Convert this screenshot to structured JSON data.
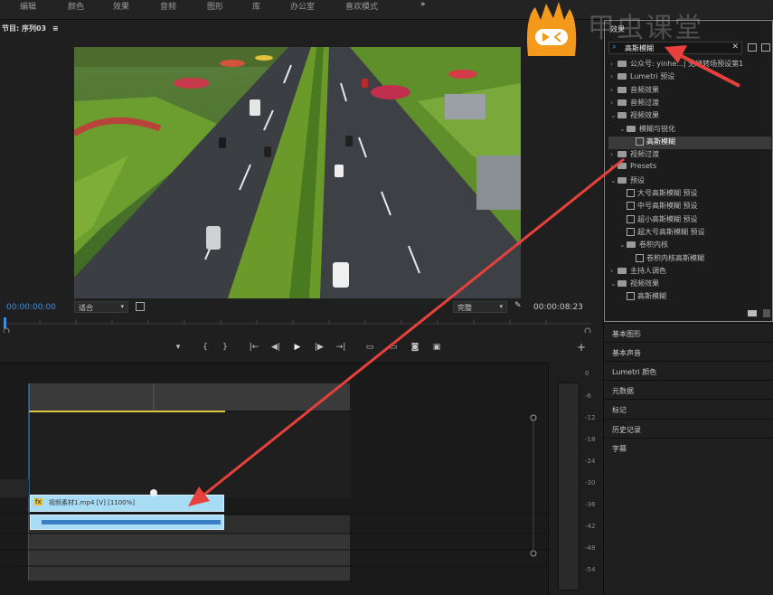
{
  "menu": [
    "编辑",
    "颜色",
    "效果",
    "音频",
    "图形",
    "库",
    "办公室",
    "喜欢模式"
  ],
  "menu_more": "»",
  "monitor": {
    "panel_title": "节目: 序列03",
    "panel_menu": "≡",
    "timecode_current": "00:00:00:00",
    "zoom_select": "适合",
    "quality_select": "完整",
    "timecode_duration": "00:00:08:23"
  },
  "transport": {
    "marker": "▾",
    "in": "{",
    "out": "}",
    "go_in": "|←",
    "step_back": "◀|",
    "play": "▶",
    "step_fwd": "|▶",
    "go_out": "→|",
    "lift": "▭",
    "extract": "▭",
    "camera": "◙",
    "compare": "▣",
    "add": "+"
  },
  "timeline": {
    "clip_label": "视频素材1.mp4 [V] [1100%]",
    "fx_badge": "fx"
  },
  "meter": {
    "ticks": [
      "0",
      "-6",
      "-12",
      "-18",
      "-24",
      "-30",
      "-36",
      "-42",
      "-48",
      "-54"
    ]
  },
  "effects_panel": {
    "title": "效果",
    "search_value": "高斯模糊",
    "tree": [
      {
        "label": "公众号: yinhe...| 无缝转场预设第1",
        "indent": 0,
        "type": "folder"
      },
      {
        "label": "Lumetri 预设",
        "indent": 0,
        "type": "folder"
      },
      {
        "label": "音频效果",
        "indent": 0,
        "type": "folder"
      },
      {
        "label": "音频过渡",
        "indent": 0,
        "type": "folder"
      },
      {
        "label": "视频效果",
        "indent": 0,
        "type": "folder-open"
      },
      {
        "label": "模糊与锐化",
        "indent": 1,
        "type": "folder-open"
      },
      {
        "label": "高斯模糊",
        "indent": 2,
        "type": "effect",
        "selected": true
      },
      {
        "label": "视频过渡",
        "indent": 0,
        "type": "folder"
      },
      {
        "label": "Presets",
        "indent": 0,
        "type": "folder"
      },
      {
        "label": "预设",
        "indent": 0,
        "type": "folder-open"
      },
      {
        "label": "大号高斯模糊 预设",
        "indent": 1,
        "type": "effect"
      },
      {
        "label": "中号高斯模糊 预设",
        "indent": 1,
        "type": "effect"
      },
      {
        "label": "超小高斯模糊 预设",
        "indent": 1,
        "type": "effect"
      },
      {
        "label": "超大号高斯模糊 预设",
        "indent": 1,
        "type": "effect"
      },
      {
        "label": "卷积内核",
        "indent": 1,
        "type": "folder-open"
      },
      {
        "label": "卷积内核高斯模糊",
        "indent": 2,
        "type": "effect"
      },
      {
        "label": "主持人调色",
        "indent": 0,
        "type": "folder"
      },
      {
        "label": "视频效果",
        "indent": 0,
        "type": "folder-open"
      },
      {
        "label": "高斯模糊",
        "indent": 1,
        "type": "effect"
      }
    ]
  },
  "panels": [
    "基本图形",
    "基本声音",
    "Lumetri 颜色",
    "元数据",
    "标记",
    "历史记录",
    "字幕"
  ],
  "watermark": "甲虫课堂",
  "colors": {
    "accent_blue": "#3d8fe0",
    "clip_blue": "#a8dcf5",
    "arrow_red": "#e8413c",
    "logo_orange": "#f39a1c"
  }
}
